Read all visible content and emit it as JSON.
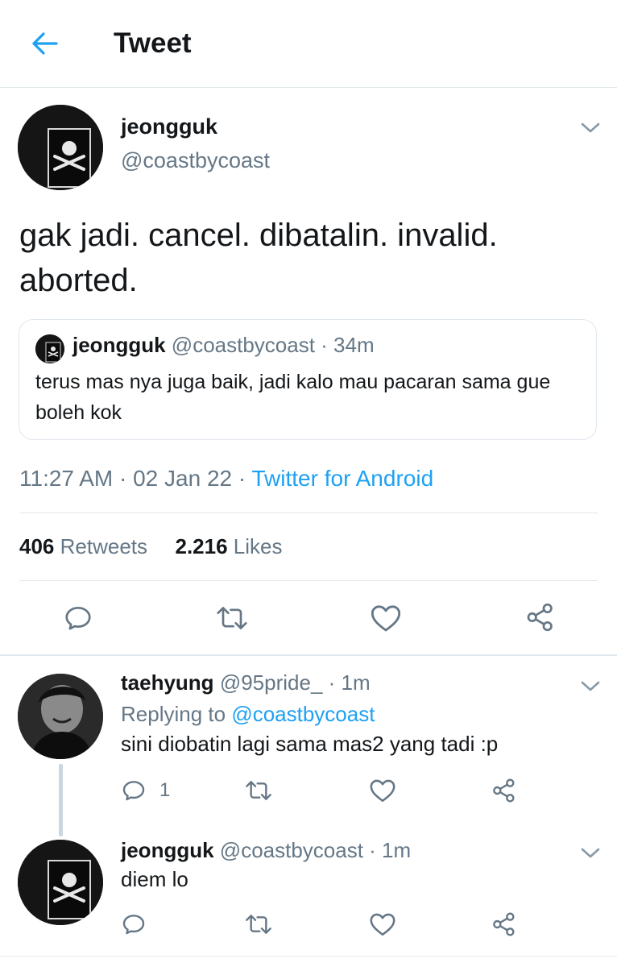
{
  "header": {
    "title": "Tweet"
  },
  "main_tweet": {
    "display_name": "jeongguk",
    "handle": "@coastbycoast",
    "text": "gak jadi. cancel. dibatalin. invalid. aborted.",
    "quoted": {
      "display_name": "jeongguk",
      "handle": "@coastbycoast",
      "time": "· 34m",
      "text": "terus mas nya juga baik, jadi kalo mau pacaran sama gue boleh kok"
    },
    "timestamp": "11:27 AM · 02 Jan 22 · ",
    "source": "Twitter for Android",
    "stats": {
      "retweets_count": "406",
      "retweets_label": "Retweets",
      "likes_count": "2.216",
      "likes_label": "Likes"
    }
  },
  "replies": [
    {
      "display_name": "taehyung",
      "handle": "@95pride_",
      "time": "· 1m",
      "replying_prefix": "Replying to ",
      "replying_to": "@coastbycoast",
      "text": "sini diobatin lagi sama mas2 yang tadi :p",
      "reply_count": "1"
    },
    {
      "display_name": "jeongguk",
      "handle": "@coastbycoast",
      "time": "· 1m",
      "text": "diem lo"
    }
  ],
  "colors": {
    "accent": "#1da1f2",
    "muted": "#657786",
    "text": "#14171a",
    "divider": "#e1e8ed"
  },
  "icons": [
    "back-arrow-icon",
    "chevron-down-icon",
    "reply-icon",
    "retweet-icon",
    "like-icon",
    "share-icon"
  ]
}
